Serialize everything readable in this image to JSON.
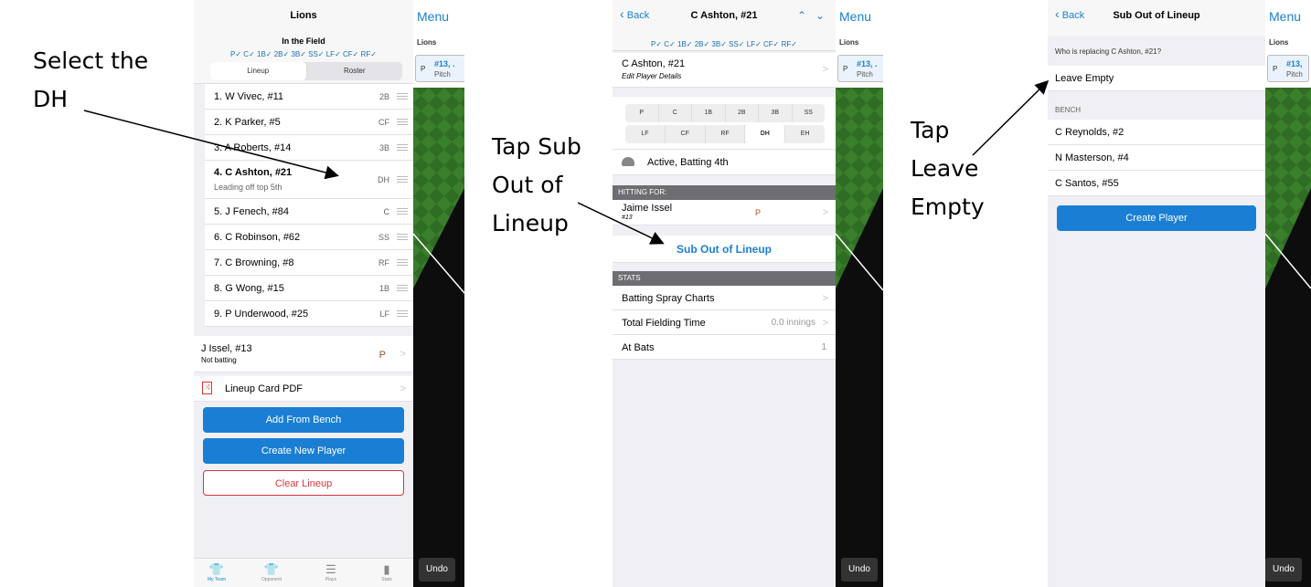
{
  "callouts": {
    "select_line1": "Select the",
    "select_line2": "DH",
    "tapsub_line1": "Tap Sub",
    "tapsub_line2": "Out of",
    "tapsub_line3": "Lineup",
    "tapleave_line1": "Tap",
    "tapleave_line2": "Leave",
    "tapleave_line3": "Empty"
  },
  "screen1": {
    "title": "Lions",
    "subtitle": "In the Field",
    "positions_check": "P✓ C✓ 1B✓ 2B✓ 3B✓ SS✓ LF✓ CF✓ RF✓",
    "tabs": [
      "Lineup",
      "Roster"
    ],
    "lineup": [
      {
        "name": "1. W Vivec, #11",
        "pos": "2B"
      },
      {
        "name": "2. K Parker, #5",
        "pos": "CF"
      },
      {
        "name": "3. A Roberts, #14",
        "pos": "3B"
      },
      {
        "name": "4. C Ashton, #21",
        "pos": "DH",
        "note": "Leading off top 5th"
      },
      {
        "name": "5. J Fenech, #84",
        "pos": "C"
      },
      {
        "name": "6. C Robinson, #62",
        "pos": "SS"
      },
      {
        "name": "7. C Browning, #8",
        "pos": "RF"
      },
      {
        "name": "8. G Wong, #15",
        "pos": "1B"
      },
      {
        "name": "9. P Underwood, #25",
        "pos": "LF"
      }
    ],
    "pitcher": {
      "name": "J Issel, #13",
      "note": "Not batting",
      "pos": "P"
    },
    "pdf_label": "Lineup Card PDF",
    "add_bench": "Add From Bench",
    "create_player": "Create New Player",
    "clear_lineup": "Clear Lineup",
    "tabbar": [
      "My Team",
      "Opponent",
      "Plays",
      "Stats"
    ]
  },
  "screen2": {
    "back": "Back",
    "title": "C Ashton, #21",
    "positions_check": "P✓ C✓ 1B✓ 2B✓ 3B✓ SS✓ LF✓ CF✓ RF✓",
    "player_name": "C Ashton, #21",
    "edit_details": "Edit Player Details",
    "pos_row1": [
      "P",
      "C",
      "1B",
      "2B",
      "3B",
      "SS"
    ],
    "pos_row2": [
      "LF",
      "CF",
      "RF",
      "DH",
      "EH"
    ],
    "status": "Active, Batting 4th",
    "hitting_for_header": "HITTING FOR:",
    "hitting_for_name": "Jaime Issel",
    "hitting_for_num": "#13",
    "hitting_for_pos": "P",
    "sub_out": "Sub Out of Lineup",
    "stats_header": "STATS",
    "stats": [
      {
        "label": "Batting Spray Charts",
        "value": ""
      },
      {
        "label": "Total Fielding Time",
        "value": "0.0 innings"
      },
      {
        "label": "At Bats",
        "value": "1"
      }
    ]
  },
  "screen3": {
    "back": "Back",
    "title": "Sub Out of Lineup",
    "question": "Who is replacing C Ashton, #21?",
    "leave_empty": "Leave Empty",
    "bench_header": "BENCH",
    "bench": [
      "C Reynolds, #2",
      "N Masterson, #4",
      "C Santos, #55"
    ],
    "create_player": "Create Player"
  },
  "side": {
    "menu": "Menu",
    "lions": "Lions",
    "card_pos": "P",
    "card_num": "#13, .",
    "card_num3": "#13,",
    "card_text": "Pitch",
    "undo": "Undo"
  },
  "colors": {
    "accent": "#1a7fd4",
    "danger": "#d9363e",
    "field": "#2d6a22"
  }
}
